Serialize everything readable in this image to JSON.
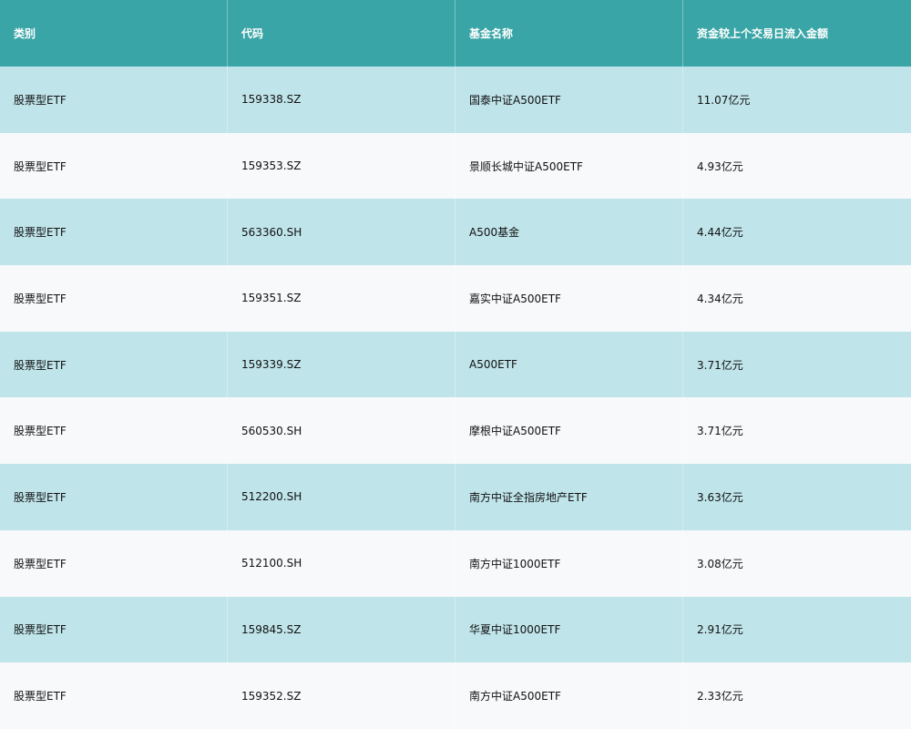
{
  "table": {
    "headers": [
      "类别",
      "代码",
      "基金名称",
      "资金较上个交易日流入金额"
    ],
    "rows": [
      [
        "股票型ETF",
        "159338.SZ",
        "国泰中证A500ETF",
        "11.07亿元"
      ],
      [
        "股票型ETF",
        "159353.SZ",
        "景顺长城中证A500ETF",
        "4.93亿元"
      ],
      [
        "股票型ETF",
        "563360.SH",
        "A500基金",
        "4.44亿元"
      ],
      [
        "股票型ETF",
        "159351.SZ",
        "嘉实中证A500ETF",
        "4.34亿元"
      ],
      [
        "股票型ETF",
        "159339.SZ",
        "A500ETF",
        "3.71亿元"
      ],
      [
        "股票型ETF",
        "560530.SH",
        "摩根中证A500ETF",
        "3.71亿元"
      ],
      [
        "股票型ETF",
        "512200.SH",
        "南方中证全指房地产ETF",
        "3.63亿元"
      ],
      [
        "股票型ETF",
        "512100.SH",
        "南方中证1000ETF",
        "3.08亿元"
      ],
      [
        "股票型ETF",
        "159845.SZ",
        "华夏中证1000ETF",
        "2.91亿元"
      ],
      [
        "股票型ETF",
        "159352.SZ",
        "南方中证A500ETF",
        "2.33亿元"
      ]
    ]
  },
  "colors": {
    "header_bg": "#3aa5a6",
    "row_odd_bg": "#bfe4ea",
    "row_even_bg": "#f8f9fb"
  }
}
